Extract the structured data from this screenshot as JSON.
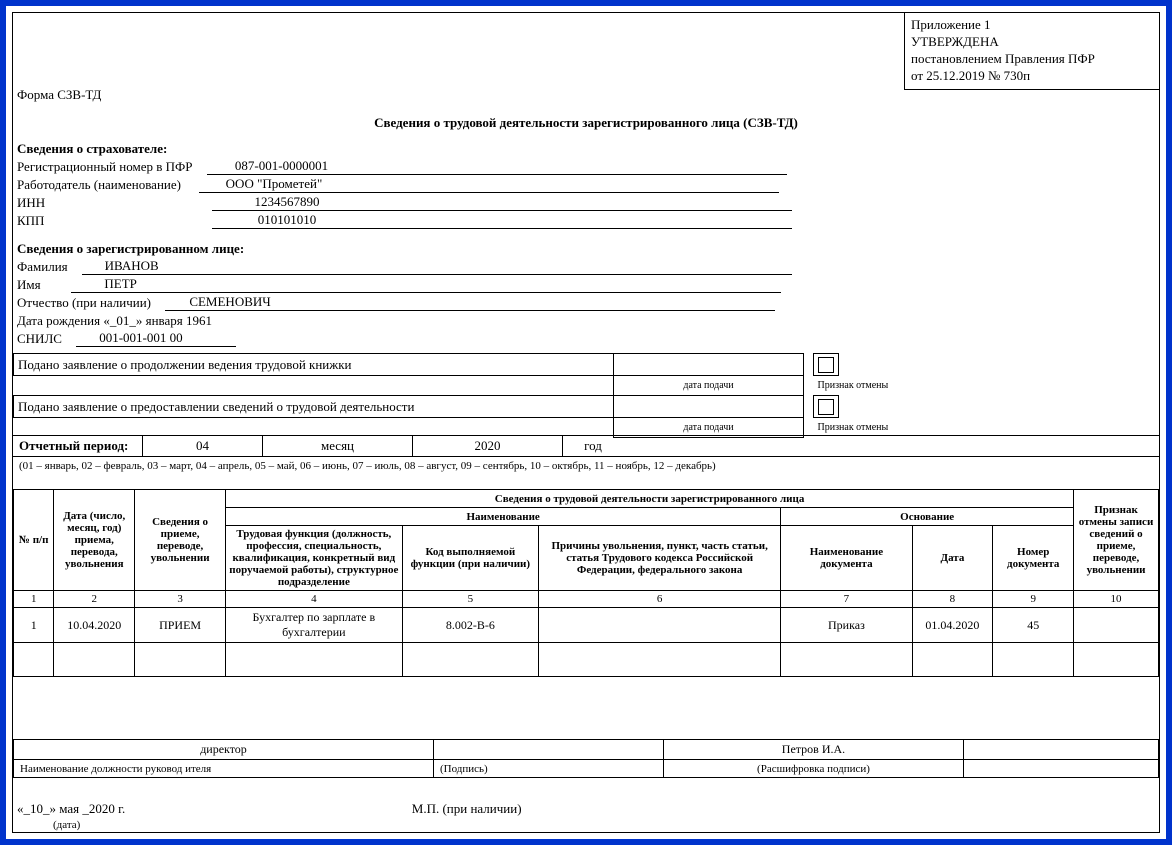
{
  "approval": {
    "line1": "Приложение 1",
    "line2": "УТВЕРЖДЕНА",
    "line3": "постановлением Правления ПФР",
    "line4": "от 25.12.2019   № 730п"
  },
  "form_code": "Форма СЗВ-ТД",
  "title": "Сведения о трудовой деятельности зарегистрированного лица (СЗВ-ТД)",
  "insurer": {
    "header": "Сведения о страхователе:",
    "reg_label": "Регистрационный номер в ПФР",
    "reg_value": "087-001-0000001",
    "employer_label": "Работодатель (наименование)",
    "employer_value": "ООО \"Прометей\"",
    "inn_label": "ИНН",
    "inn_value": "1234567890",
    "kpp_label": "КПП",
    "kpp_value": "010101010"
  },
  "person": {
    "header": "Сведения о зарегистрированном лице:",
    "lastname_label": "Фамилия",
    "lastname_value": "ИВАНОВ",
    "firstname_label": "Имя",
    "firstname_value": "ПЕТР",
    "patronymic_label": "Отчество (при наличии)",
    "patronymic_value": "СЕМЕНОВИЧ",
    "dob_composite": "Дата рождения «_01_» января  1961",
    "snils_label": "СНИЛС",
    "snils_value": "001-001-001 00"
  },
  "statements": {
    "stmt1": "Подано заявление о продолжении ведения трудовой книжки",
    "stmt2": "Подано заявление о предоставлении сведений о трудовой деятельности",
    "date_filed_label": "дата подачи",
    "cancel_label": "Признак отмены"
  },
  "period": {
    "label": "Отчетный период:",
    "month_value": "04",
    "month_label": "месяц",
    "year_value": "2020",
    "year_label": "год",
    "note": "(01 – январь, 02 – февраль, 03 – март, 04 – апрель, 05 – май, 06 – июнь, 07 – июль, 08 – август, 09 – сентябрь, 10 – октябрь, 11 – ноябрь, 12 – декабрь)"
  },
  "table": {
    "caption": "Сведения о трудовой деятельности зарегистрированного лица",
    "headers": {
      "col1": "№ п/п",
      "col2": "Дата (число, месяц, год) приема, перевода, увольнения",
      "col3": "Сведения о приеме, переводе, увольнении",
      "naimenovanie": "Наименование",
      "col4": "Трудовая функция (должность, профессия, специальность, квалификация, конкретный вид поручаемой работы), структурное подразделение",
      "col5": "Код выполняемой функции (при наличии)",
      "col6": "Причины увольнения, пункт, часть статьи, статья Трудового кодекса Российской Федерации, федерального закона",
      "osnovanie": "Основание",
      "col7": "Наименование документа",
      "col8": "Дата",
      "col9": "Номер документа",
      "col10": "Признак отмены записи сведений о приеме, переводе, увольнении"
    },
    "numrow": [
      "1",
      "2",
      "3",
      "4",
      "5",
      "6",
      "7",
      "8",
      "9",
      "10"
    ],
    "rows": [
      {
        "n": "1",
        "date": "10.04.2020",
        "action": "ПРИЕМ",
        "function": "Бухгалтер по зарплате в бухгалтерии",
        "code": "8.002-В-6",
        "reason": "",
        "doc_name": "Приказ",
        "doc_date": "01.04.2020",
        "doc_num": "45",
        "cancel": ""
      }
    ]
  },
  "signature": {
    "position_value": "директор",
    "position_label": "Наименование должности руковод ителя",
    "signature_label": "(Подпись)",
    "decode_value": "Петров И.А.",
    "decode_label": "(Расшифровка подписи)",
    "date_text": "«_10_»  мая  _2020 г.",
    "mp_label": "М.П. (при наличии)",
    "date_caption": "(дата)"
  }
}
